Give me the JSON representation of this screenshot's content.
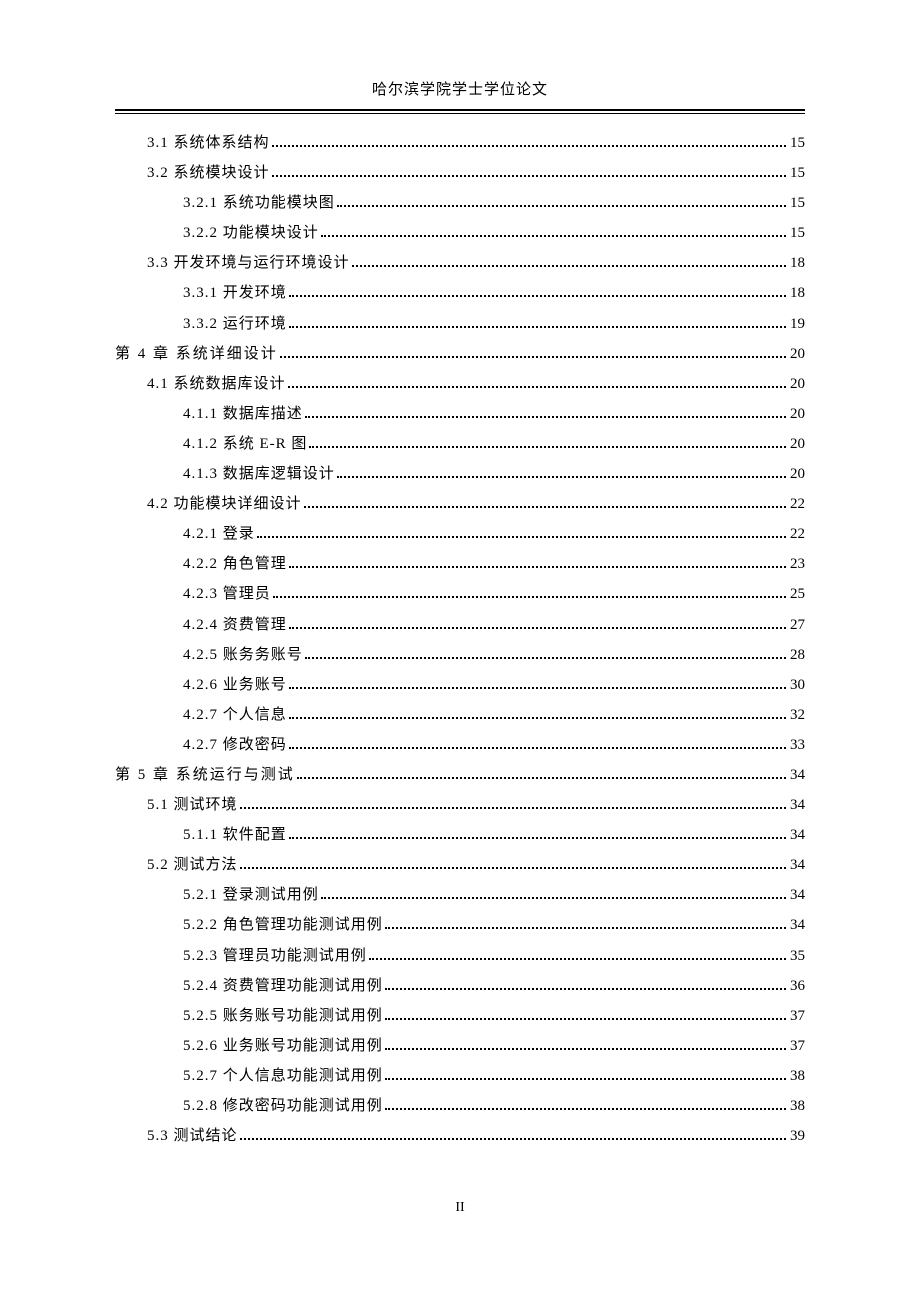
{
  "header": "哈尔滨学院学士学位论文",
  "footer_page": "II",
  "toc": [
    {
      "level": 2,
      "label": "3.1  系统体系结构 ",
      "page": "15"
    },
    {
      "level": 2,
      "label": "3.2 系统模块设计",
      "page": "15"
    },
    {
      "level": 3,
      "label": "3.2.1  系统功能模块图",
      "page": "15"
    },
    {
      "level": 3,
      "label": "3.2.2  功能模块设计",
      "page": "15"
    },
    {
      "level": 2,
      "label": "3.3 开发环境与运行环境设计",
      "page": "18"
    },
    {
      "level": 3,
      "label": "3.3.1  开发环境",
      "page": "18"
    },
    {
      "level": 3,
      "label": "3.3.2  运行环境",
      "page": "19"
    },
    {
      "level": 1,
      "label": "第 4 章   系统详细设计",
      "page": "20",
      "chapter": true
    },
    {
      "level": 2,
      "label": "4.1 系统数据库设计 ",
      "page": "20"
    },
    {
      "level": 3,
      "label": "4.1.1  数据库描述",
      "page": "20"
    },
    {
      "level": 3,
      "label": "4.1.2  系统 E-R 图 ",
      "page": "20"
    },
    {
      "level": 3,
      "label": "4.1.3 数据库逻辑设计",
      "page": "20"
    },
    {
      "level": 2,
      "label": "4.2   功能模块详细设计",
      "page": "22"
    },
    {
      "level": 3,
      "label": "4.2.1  登录",
      "page": "22"
    },
    {
      "level": 3,
      "label": "4.2.2  角色管理",
      "page": "23"
    },
    {
      "level": 3,
      "label": "4.2.3  管理员",
      "page": "25"
    },
    {
      "level": 3,
      "label": "4.2.4  资费管理",
      "page": "27"
    },
    {
      "level": 3,
      "label": "4.2.5  账务务账号",
      "page": "28"
    },
    {
      "level": 3,
      "label": "4.2.6  业务账号",
      "page": "30"
    },
    {
      "level": 3,
      "label": "4.2.7  个人信息",
      "page": "32"
    },
    {
      "level": 3,
      "label": "4.2.7  修改密码",
      "page": "33"
    },
    {
      "level": 1,
      "label": "第 5 章  系统运行与测试",
      "page": "34",
      "chapter": true
    },
    {
      "level": 2,
      "label": "5.1  测试环境 ",
      "page": "34"
    },
    {
      "level": 3,
      "label": "5.1.1  软件配置",
      "page": "34"
    },
    {
      "level": 2,
      "label": "5.2   测试方法",
      "page": "34"
    },
    {
      "level": 3,
      "label": "5.2.1  登录测试用例",
      "page": "34"
    },
    {
      "level": 3,
      "label": "5.2.2  角色管理功能测试用例",
      "page": "34"
    },
    {
      "level": 3,
      "label": "5.2.3  管理员功能测试用例",
      "page": "35"
    },
    {
      "level": 3,
      "label": "5.2.4  资费管理功能测试用例",
      "page": "36"
    },
    {
      "level": 3,
      "label": "5.2.5  账务账号功能测试用例",
      "page": "37"
    },
    {
      "level": 3,
      "label": "5.2.6  业务账号功能测试用例",
      "page": "37"
    },
    {
      "level": 3,
      "label": "5.2.7  个人信息功能测试用例",
      "page": "38"
    },
    {
      "level": 3,
      "label": "5.2.8  修改密码功能测试用例",
      "page": "38"
    },
    {
      "level": 2,
      "label": "5.3   测试结论",
      "page": "39"
    }
  ]
}
